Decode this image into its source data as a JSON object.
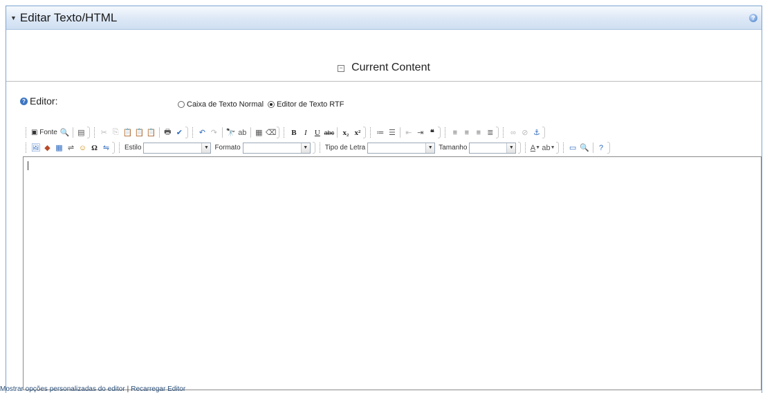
{
  "panel": {
    "collapse_glyph": "▼",
    "title": "Editar Texto/HTML",
    "help_icon": "?"
  },
  "section": {
    "toggle_glyph": "−",
    "title": "Current Content"
  },
  "editor_mode": {
    "label": "Editor:",
    "help_icon": "?",
    "options": [
      {
        "label": "Caixa de Texto Normal",
        "selected": false
      },
      {
        "label": "Editor de Texto RTF",
        "selected": true
      }
    ]
  },
  "toolbar_row1": {
    "source_label": "Fonte",
    "buttons": {
      "source_icon": "▣",
      "preview_icon": "🔍",
      "templates_icon": "▤",
      "cut_icon": "✂",
      "copy_icon": "⎘",
      "paste_icon": "📋",
      "paste_text_icon": "📋",
      "paste_word_icon": "📋",
      "print_icon": "🖶",
      "spellcheck_icon": "✔",
      "undo_icon": "↶",
      "redo_icon": "↷",
      "find_icon": "🔭",
      "replace_icon": "ab",
      "select_all_icon": "▦",
      "remove_format_icon": "⌫",
      "bold": "B",
      "italic": "I",
      "underline": "U",
      "strike": "abc",
      "subscript": "x₂",
      "superscript": "x²",
      "numbered_list_icon": "≔",
      "bulleted_list_icon": "☰",
      "outdent_icon": "⇤",
      "indent_icon": "⇥",
      "blockquote_icon": "❝",
      "align_left_icon": "≡",
      "align_center_icon": "≡",
      "align_right_icon": "≡",
      "justify_icon": "≣",
      "link_icon": "∞",
      "unlink_icon": "⊘",
      "anchor_icon": "⚓"
    }
  },
  "toolbar_row2": {
    "buttons": {
      "image_icon": "🖼",
      "flash_icon": "◆",
      "table_icon": "▦",
      "horizontal_rule_icon": "⇌",
      "smiley_icon": "☺",
      "special_char_icon": "Ω",
      "page_break_icon": "⇋",
      "text_color_icon": "A",
      "bg_color_icon": "ab",
      "maximize_icon": "▭",
      "show_blocks_icon": "🔍",
      "about_icon": "?"
    },
    "style_label": "Estilo",
    "style_value": "",
    "format_label": "Formato",
    "format_value": "",
    "font_label": "Tipo de Letra",
    "font_value": "",
    "size_label": "Tamanho",
    "size_value": ""
  },
  "editor_content": "",
  "footer": {
    "custom_options_link": "Mostrar opções personalizadas do editor",
    "separator": "|",
    "reload_link": "Recarregar Editor"
  },
  "colors": {
    "title_bar_gradient_top": "#f6f9fd",
    "title_bar_gradient_bottom": "#cfdff1",
    "frame_border": "#7aa2cf",
    "link": "#2a4f7a"
  }
}
